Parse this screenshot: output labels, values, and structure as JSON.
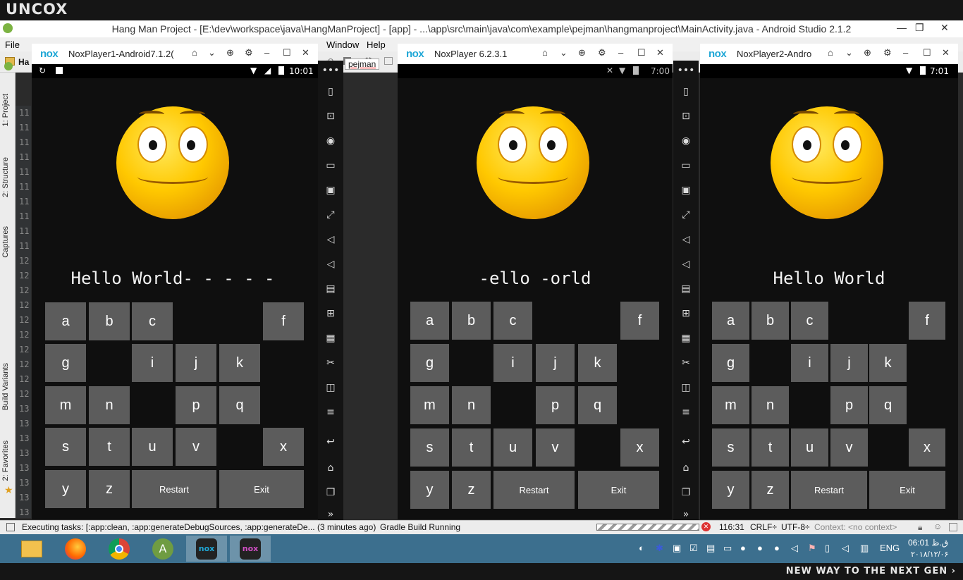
{
  "overlay": {
    "brand": "UNCOX",
    "slogan": "NEW WAY TO THE NEXT GEN ›"
  },
  "studio": {
    "title": "Hang Man Project - [E:\\dev\\workspace\\java\\HangManProject] - [app] - ...\\app\\src\\main\\java\\com\\example\\pejman\\hangmanproject\\MainActivity.java - Android Studio 2.1.2",
    "menu": {
      "file": "File",
      "window": "Window",
      "help": "Help"
    },
    "breadcrumb": {
      "ha": "Ha",
      "pejman": "pejman"
    },
    "side_tabs": [
      "1: Project",
      "2: Structure",
      "Captures",
      "Build Variants",
      "2: Favorites"
    ],
    "gutter": [
      "11",
      "11",
      "11",
      "11",
      "11",
      "11",
      "11",
      "11",
      "11",
      "11",
      "12",
      "12",
      "12",
      "12",
      "12",
      "12",
      "12",
      "12",
      "12",
      "12",
      "13",
      "13",
      "13",
      "13",
      "13",
      "13",
      "13",
      "13"
    ],
    "status": {
      "tasks": "Executing tasks: [:app:clean, :app:generateDebugSources, :app:generateDe... (3 minutes ago)",
      "gradle": "Gradle Build Running",
      "position": "116:31",
      "crlf": "CRLF÷",
      "encoding": "UTF-8÷",
      "context": "Context: <no context>"
    }
  },
  "players": [
    {
      "title": "NoxPlayer1-Android7.1.2(",
      "time": "10:01",
      "word": "Hello World- - - - -"
    },
    {
      "title": "NoxPlayer 6.2.3.1",
      "time": "7:00",
      "word": "-ello -orld"
    },
    {
      "title": "NoxPlayer2-Andro",
      "time": "7:01",
      "word": "Hello World"
    }
  ],
  "nox_logo": "nox",
  "keys": {
    "a": "a",
    "b": "b",
    "c": "c",
    "f": "f",
    "g": "g",
    "i": "i",
    "j": "j",
    "k": "k",
    "m": "m",
    "n": "n",
    "p": "p",
    "q": "q",
    "s": "s",
    "t": "t",
    "u": "u",
    "v": "v",
    "x": "x",
    "y": "y",
    "z": "z",
    "restart": "Restart",
    "exit": "Exit"
  },
  "taskbar": {
    "lang": "ENG",
    "time": "06:01 ق.ظ",
    "date": "۲۰۱۸/۱۲/۰۶"
  },
  "colors": {
    "key_bg": "#5c5c5c",
    "screen_bg": "#0f0f0f",
    "nox_blue": "#1fa7d6",
    "taskbar": "#3c6f8e"
  }
}
